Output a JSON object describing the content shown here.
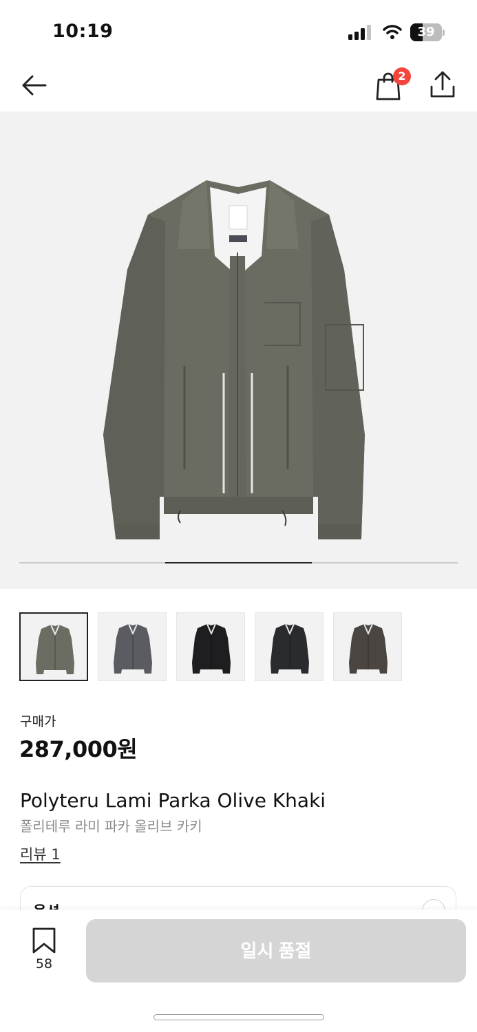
{
  "status_bar": {
    "time": "10:19",
    "battery_level": "39",
    "battery_fraction": 0.39,
    "icons": [
      "signal-icon",
      "wifi-icon",
      "battery-icon"
    ]
  },
  "header": {
    "icons": [
      "back-arrow-icon",
      "shopping-bag-icon",
      "share-icon"
    ],
    "cart_count": "2",
    "badge_color": "#f1453d"
  },
  "gallery": {
    "image_count": 3,
    "current_index": 2,
    "thumbnails": [
      {
        "color_name": "olive",
        "color": "#6b6d63",
        "selected": true
      },
      {
        "color_name": "grey",
        "color": "#5a5c62",
        "selected": false
      },
      {
        "color_name": "black",
        "color": "#1e1e20",
        "selected": false
      },
      {
        "color_name": "charcoal",
        "color": "#2a2b2e",
        "selected": false
      },
      {
        "color_name": "brown",
        "color": "#4a4540",
        "selected": false
      }
    ]
  },
  "product": {
    "price_label": "구매가",
    "price": "287,000원",
    "name_en": "Polyteru Lami Parka Olive Khaki",
    "name_ko": "폴리테루 라미 파카 올리브 카키",
    "review_link": "리뷰 1"
  },
  "options": {
    "label": "옵션"
  },
  "bottom_bar": {
    "bookmark_count": "58",
    "cta_label": "일시 품절",
    "cta_color": "#d5d5d5"
  }
}
